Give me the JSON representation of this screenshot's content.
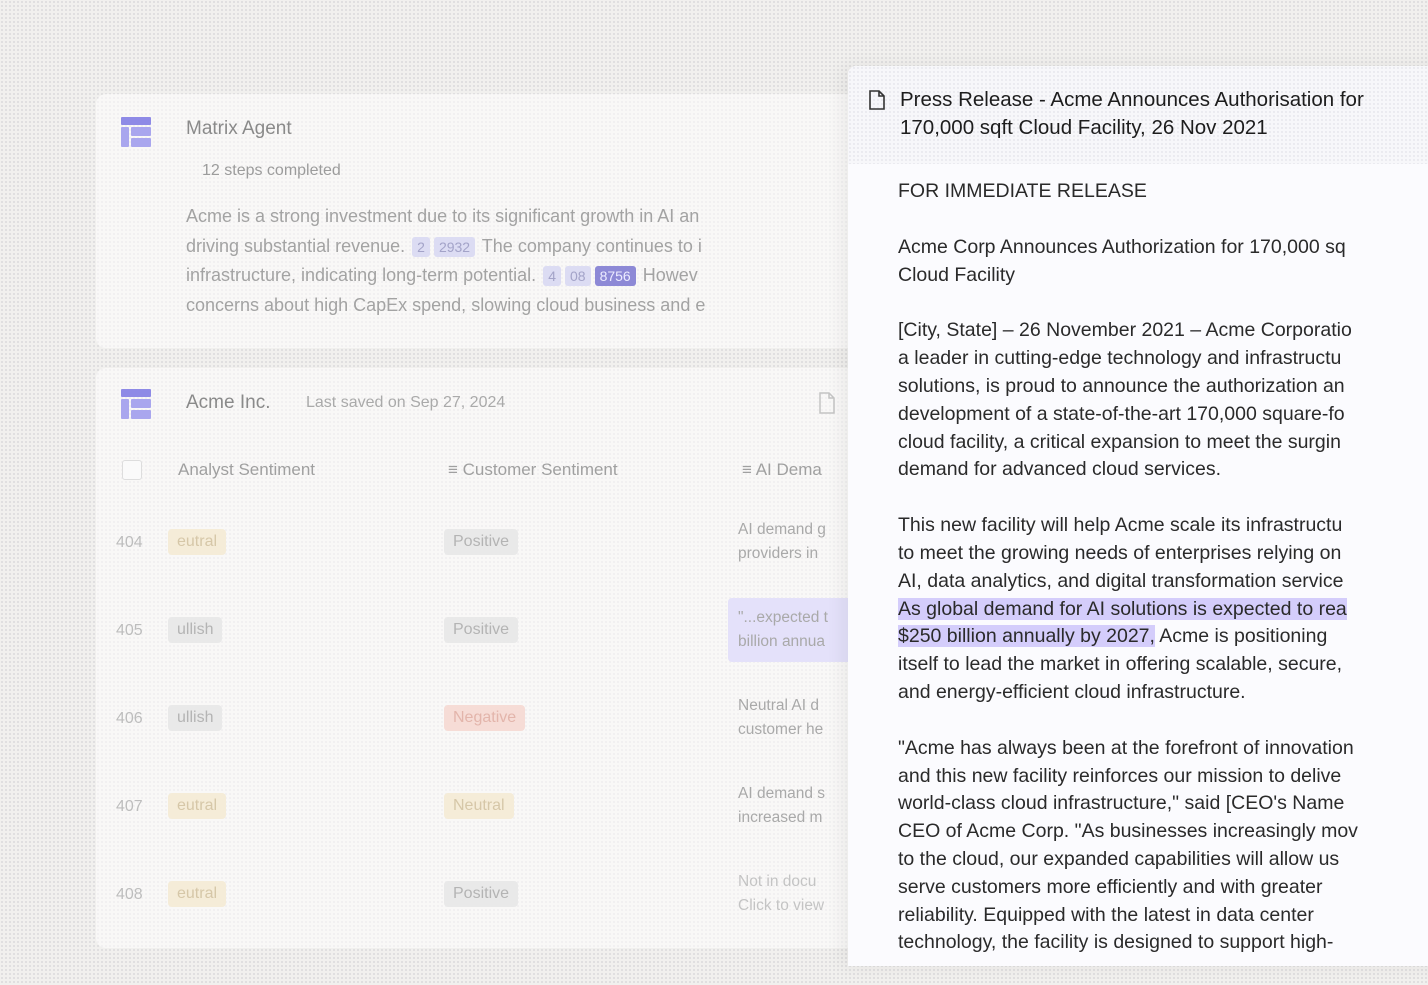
{
  "agent_card": {
    "title": "Matrix Agent",
    "steps": "12 steps completed",
    "line1": "Acme is a strong investment due to its significant growth in AI an",
    "line2_a": "driving substantial revenue.",
    "line2_cite1": "2",
    "line2_cite2": "2932",
    "line2_b": "The company continues to i",
    "line3_a": "infrastructure, indicating long-term potential.",
    "line3_cite1": "4",
    "line3_cite2": "08",
    "line3_cite3": "8756",
    "line3_b": "Howev",
    "line4": "concerns about high CapEx spend, slowing cloud business and e"
  },
  "table_card": {
    "title": "Acme Inc.",
    "saved": "Last saved on Sep 27, 2024",
    "columns": [
      "Analyst Sentiment",
      "Customer Sentiment",
      "AI Dema"
    ],
    "rows": [
      {
        "num": "404",
        "analyst": "eutral",
        "customer": "Positive",
        "ai": [
          "AI demand g",
          "providers in"
        ]
      },
      {
        "num": "405",
        "analyst": "ullish",
        "customer": "Positive",
        "ai": [
          "\"...expected t",
          "billion annua"
        ]
      },
      {
        "num": "406",
        "analyst": "ullish",
        "customer": "Negative",
        "ai": [
          "Neutral AI d",
          "customer he"
        ]
      },
      {
        "num": "407",
        "analyst": "eutral",
        "customer": "Neutral",
        "ai": [
          "AI demand s",
          "increased m"
        ]
      },
      {
        "num": "408",
        "analyst": "eutral",
        "customer": "Positive",
        "ai": [
          "Not in docu",
          "Click to view"
        ]
      }
    ]
  },
  "document": {
    "title": "Press Release - Acme Announces Authorisation for\n170,000 sqft Cloud Facility, 26 Nov 2021",
    "p1": "FOR IMMEDIATE RELEASE",
    "p2": "Acme Corp Announces Authorization for 170,000 sq\nCloud Facility",
    "p3": "[City, State] – 26 November 2021 – Acme Corporatio\na leader in cutting-edge technology and infrastructu\nsolutions, is proud to announce the authorization an\ndevelopment of a state-of-the-art 170,000 square-fo\ncloud facility, a critical expansion to meet the surgin\ndemand for advanced cloud services.",
    "p4_a": "This new facility will help Acme scale its infrastructu\nto meet the growing needs of enterprises relying on\nAI, data analytics, and digital transformation service\n",
    "p4_highlight": "As global demand for AI solutions is expected to rea\n$250 billion annually by 2027,",
    "p4_b": " Acme is positioning\nitself to lead the market in offering scalable, secure,\nand energy-efficient cloud infrastructure.",
    "p5": "\"Acme has always been at the forefront of innovation\nand this new facility reinforces our mission to delive\nworld-class cloud infrastructure,\" said [CEO's Name\nCEO of Acme Corp. \"As businesses increasingly mov\nto the cloud, our expanded capabilities will allow us\nserve customers more efficiently and with greater\nreliability. Equipped with the latest in data center\ntechnology, the facility is designed to support high-"
  },
  "colors": {
    "accent": "#6b63e8",
    "highlight": "#d4cdfb",
    "grid_icon": "#8e8ae6"
  }
}
